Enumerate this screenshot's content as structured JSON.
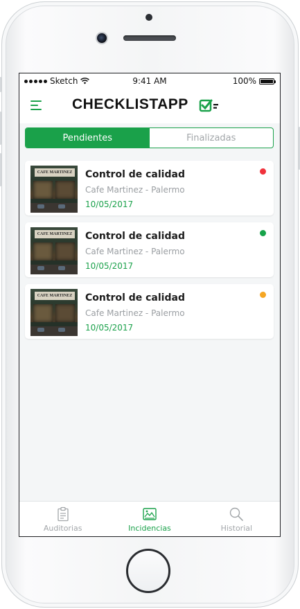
{
  "status_bar": {
    "carrier": "Sketch",
    "time": "9:41 AM",
    "battery": "100%"
  },
  "header": {
    "title": "CHECKLISTAPP"
  },
  "segment": {
    "pending": "Pendientes",
    "finished": "Finalizadas",
    "selected": "Pendientes"
  },
  "cards": [
    {
      "title": "Control de calidad",
      "subtitle": "Cafe Martinez  - Palermo",
      "date": "10/05/2017",
      "status_color": "#f0323c",
      "image_sign": "CAFE MARTINEZ"
    },
    {
      "title": "Control de calidad",
      "subtitle": "Cafe Martinez  - Palermo",
      "date": "10/05/2017",
      "status_color": "#16a34a",
      "image_sign": "CAFE MARTINEZ"
    },
    {
      "title": "Control de calidad",
      "subtitle": "Cafe Martinez  - Palermo",
      "date": "10/05/2017",
      "status_color": "#f5a623",
      "image_sign": "CAFE MARTINEZ"
    }
  ],
  "tabs": [
    {
      "label": "Auditorias",
      "icon": "clipboard-icon"
    },
    {
      "label": "Incidencias",
      "icon": "picture-icon"
    },
    {
      "label": "Historial",
      "icon": "search-icon"
    }
  ],
  "active_tab": "Incidencias",
  "colors": {
    "accent": "#1aa14a",
    "background": "#f4f6f7"
  }
}
